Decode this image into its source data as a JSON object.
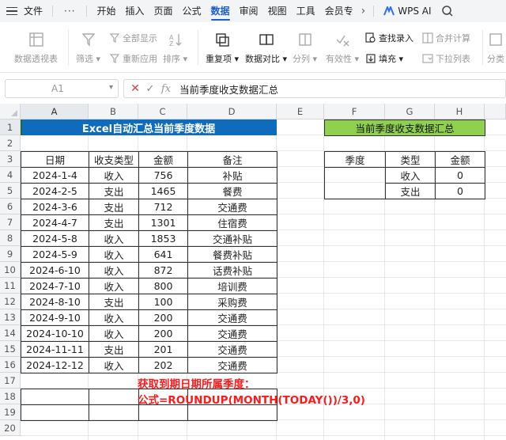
{
  "menu": {
    "file": "文件",
    "more": "···",
    "tabs": [
      "开始",
      "插入",
      "页面",
      "公式",
      "数据",
      "审阅",
      "视图",
      "工具",
      "会员专"
    ],
    "active_tab": "数据",
    "wps_ai": "WPS AI",
    "accent_color": "#1c5fcf"
  },
  "ribbon": {
    "pivot": "数据透视表",
    "filter": "筛选",
    "show_all": "全部显示",
    "reapply": "重新应用",
    "sort": "排序",
    "dup": "重复项",
    "compare": "数据对比",
    "split": "分列",
    "validity": "有效性",
    "find_entry": "查找录入",
    "fill": "填充",
    "merge_calc": "合并计算",
    "dropdown_list": "下拉列表",
    "classify": "分类"
  },
  "formula_bar": {
    "cell_ref": "A1",
    "content": "当前季度收支数据汇总"
  },
  "columns": [
    "A",
    "B",
    "C",
    "D",
    "E",
    "F",
    "G",
    "H"
  ],
  "rows": [
    "1",
    "2",
    "3",
    "4",
    "5",
    "6",
    "7",
    "8",
    "9",
    "10",
    "11",
    "12",
    "13",
    "14",
    "15",
    "16",
    "17",
    "18",
    "19",
    "20"
  ],
  "main_table": {
    "title": "Excel自动汇总当前季度数据",
    "title_bg": "#0f6cbd",
    "headers": [
      "日期",
      "收支类型",
      "金额",
      "备注"
    ],
    "rows": [
      [
        "2024-1-4",
        "收入",
        "756",
        "补贴"
      ],
      [
        "2024-2-5",
        "支出",
        "1465",
        "餐费"
      ],
      [
        "2024-3-6",
        "支出",
        "712",
        "交通费"
      ],
      [
        "2024-4-7",
        "支出",
        "1301",
        "住宿费"
      ],
      [
        "2024-5-8",
        "收入",
        "1853",
        "交通补贴"
      ],
      [
        "2024-5-9",
        "收入",
        "641",
        "餐费补贴"
      ],
      [
        "2024-6-10",
        "收入",
        "872",
        "话费补贴"
      ],
      [
        "2024-7-10",
        "收入",
        "800",
        "培训费"
      ],
      [
        "2024-8-10",
        "支出",
        "100",
        "采购费"
      ],
      [
        "2024-9-10",
        "收入",
        "200",
        "交通费"
      ],
      [
        "2024-10-10",
        "收入",
        "200",
        "交通费"
      ],
      [
        "2024-11-11",
        "支出",
        "201",
        "交通费"
      ],
      [
        "2024-12-12",
        "收入",
        "202",
        "交通费"
      ]
    ]
  },
  "summary_table": {
    "title": "当前季度收支数据汇总",
    "title_bg": "#8fd14f",
    "headers": [
      "季度",
      "类型",
      "金额"
    ],
    "rows": [
      [
        "",
        "收入",
        "0"
      ],
      [
        "",
        "支出",
        "0"
      ]
    ]
  },
  "note": {
    "line1": "获取到期日期所属季度：",
    "line2": "公式=ROUNDUP(MONTH(TODAY())/3,0)",
    "color": "#ff1a1a"
  }
}
